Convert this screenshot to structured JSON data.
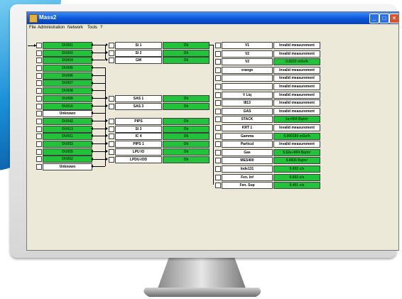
{
  "window": {
    "title": "Mass2"
  },
  "menu": [
    "File",
    "Administration",
    "Network",
    "Tools",
    "?"
  ],
  "left_devices": [
    {
      "label": "DU001",
      "state": "on"
    },
    {
      "label": "DU002",
      "state": "on"
    },
    {
      "label": "DU004",
      "state": "on"
    },
    {
      "label": "DU005",
      "state": "on"
    },
    {
      "label": "DU006",
      "state": "on"
    },
    {
      "label": "DU007",
      "state": "on"
    },
    {
      "label": "DU008",
      "state": "on"
    },
    {
      "label": "DU009",
      "state": "on"
    },
    {
      "label": "DU010",
      "state": "on"
    },
    {
      "label": "Unknown",
      "state": "off"
    },
    {
      "label": "DU042",
      "state": "on"
    },
    {
      "label": "DU013",
      "state": "on"
    },
    {
      "label": "DU051",
      "state": "on"
    },
    {
      "label": "DU053",
      "state": "on"
    },
    {
      "label": "DU055",
      "state": "on"
    },
    {
      "label": "DU062",
      "state": "on"
    },
    {
      "label": "Unknown",
      "state": "off"
    }
  ],
  "mid_sensors": [
    {
      "label": "SI 1",
      "status": "Ok"
    },
    {
      "label": "SI 2",
      "status": "Ok"
    },
    {
      "label": "GM",
      "status": "Ok"
    },
    {
      "label": "SAS 1",
      "status": "Ok"
    },
    {
      "label": "SAS 3",
      "status": "Ok"
    },
    {
      "label": "PIPS",
      "status": "Ok"
    },
    {
      "label": "SI 3",
      "status": "Ok"
    },
    {
      "label": "IC 4",
      "status": "Ok"
    },
    {
      "label": "PIPS 1",
      "status": "Ok"
    },
    {
      "label": "LPU IO",
      "status": "Ok"
    },
    {
      "label": "LPDU-IOD",
      "status": "Ok"
    }
  ],
  "measurements": [
    {
      "label": "V1",
      "value": "Invalid measurement",
      "state": "invalid"
    },
    {
      "label": "V2",
      "value": "Invalid measurement",
      "state": "invalid"
    },
    {
      "label": "V2",
      "value": "0.0223 mSv/h",
      "state": "ok"
    },
    {
      "label": "xrange",
      "value": "Invalid measurement",
      "state": "invalid"
    },
    {
      "label": "",
      "value": "Invalid measurement",
      "state": "invalid"
    },
    {
      "label": "",
      "value": "Invalid measurement",
      "state": "invalid"
    },
    {
      "label": "V Liq",
      "value": "Invalid measurement",
      "state": "invalid"
    },
    {
      "label": "I813",
      "value": "Invalid measurement",
      "state": "invalid"
    },
    {
      "label": "GAS",
      "value": "Invalid measurement",
      "state": "invalid"
    },
    {
      "label": "STACK",
      "value": "1e+004 Bq/m³",
      "state": "ok"
    },
    {
      "label": "KRT 1",
      "value": "Invalid measurement",
      "state": "invalid"
    },
    {
      "label": "Gamma",
      "value": "0.000189 mSv/h",
      "state": "ok"
    },
    {
      "label": "Particul",
      "value": "Invalid measurement",
      "state": "invalid"
    },
    {
      "label": "Gas",
      "value": "5.62e+004 Bq/m³",
      "state": "ok"
    },
    {
      "label": "MES400",
      "value": "0.0835 Bq/m³",
      "state": "ok"
    },
    {
      "label": "Iode131",
      "value": "0.602 c/s",
      "state": "ok"
    },
    {
      "label": "Fen. Inf",
      "value": "0.602 c/s",
      "state": "ok"
    },
    {
      "label": "Fen. Sup",
      "value": "0.401 c/s",
      "state": "ok"
    }
  ],
  "colors": {
    "ok": "#22c33a",
    "invalid": "#ffffff"
  }
}
